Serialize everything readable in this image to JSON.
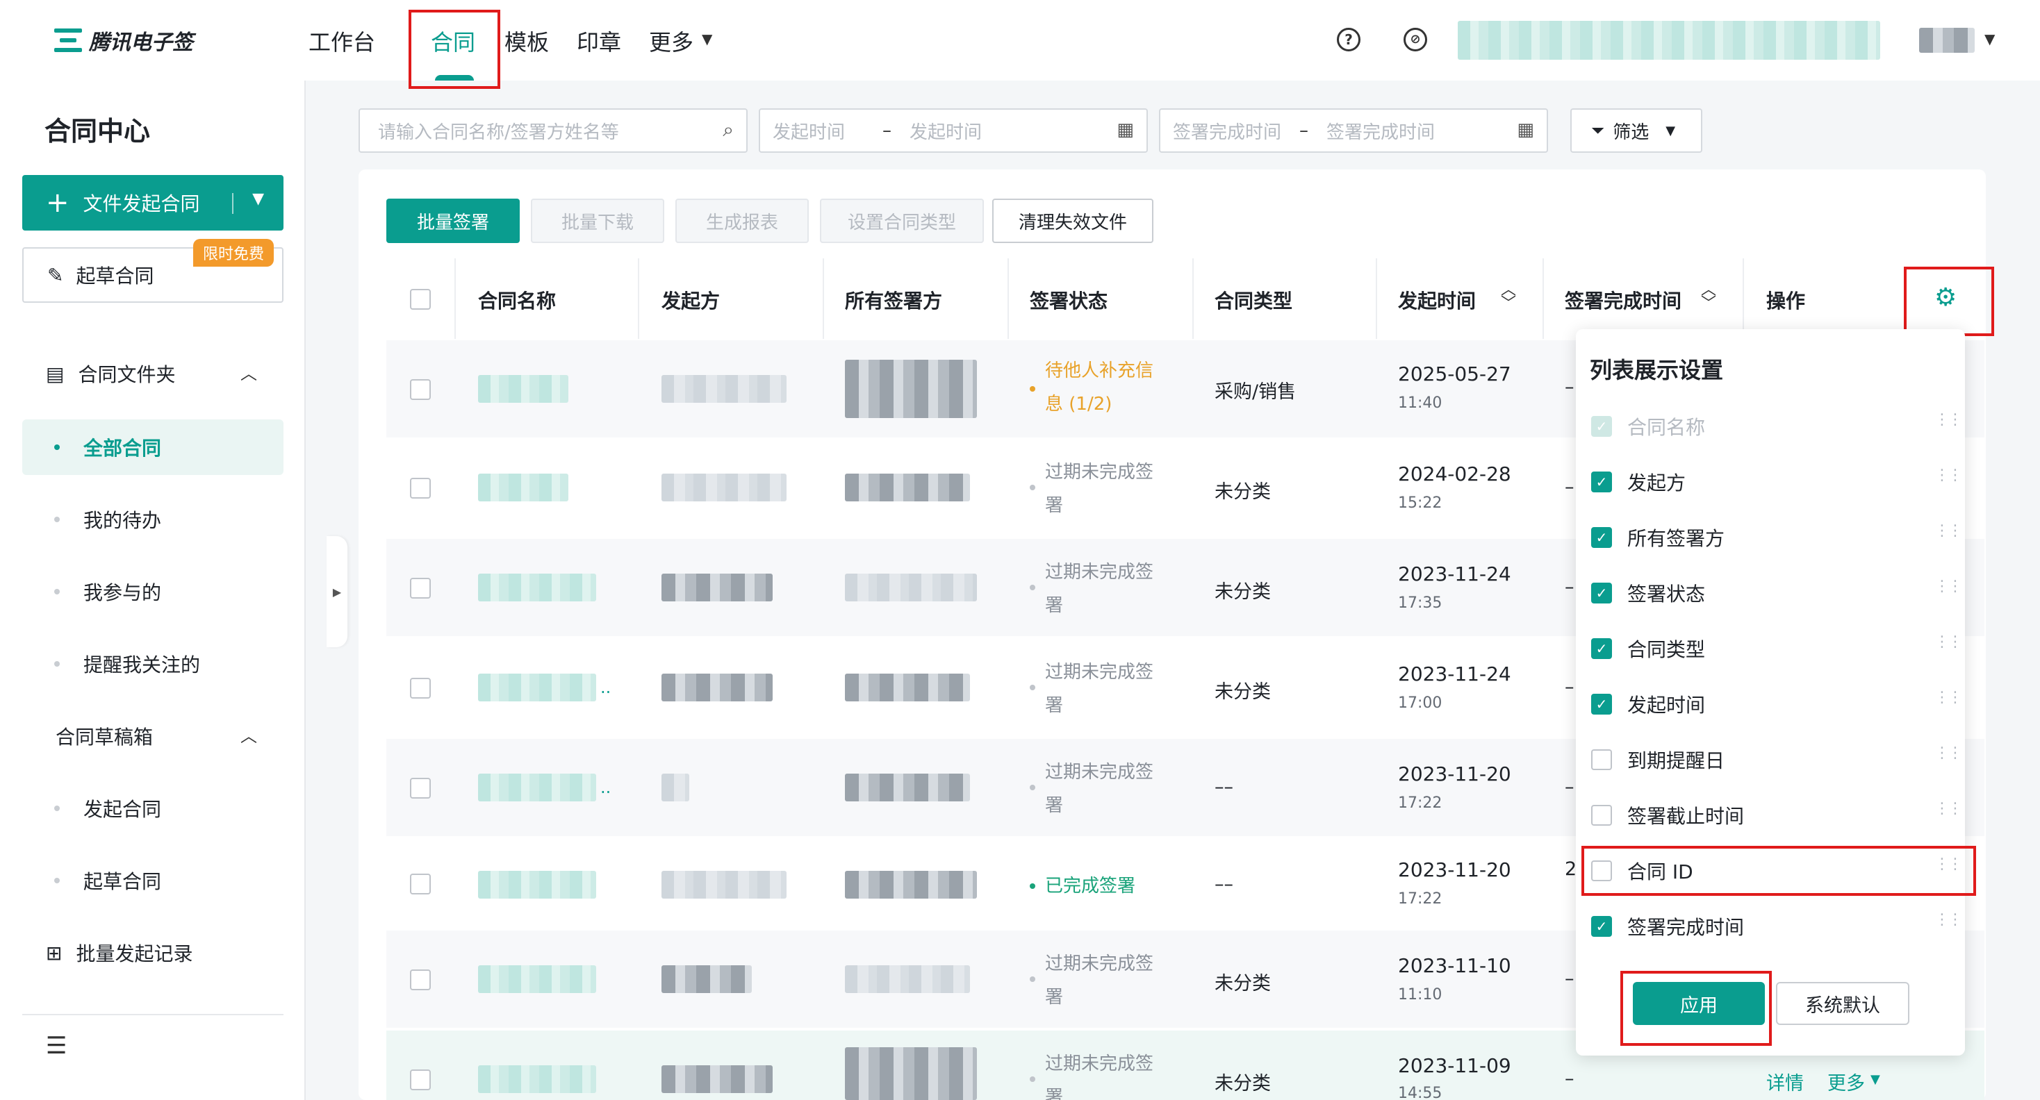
{
  "brand": {
    "name": "腾讯电子签"
  },
  "nav": {
    "items": [
      {
        "label": "工作台"
      },
      {
        "label": "合同"
      },
      {
        "label": "模板"
      },
      {
        "label": "印章"
      },
      {
        "label": "更多"
      }
    ]
  },
  "sidebar": {
    "title": "合同中心",
    "start_button": "文件发起合同",
    "draft_button": "起草合同",
    "badge": "限时免费",
    "folder_section": "合同文件夹",
    "folder_items": [
      {
        "label": "全部合同"
      },
      {
        "label": "我的待办"
      },
      {
        "label": "我参与的"
      },
      {
        "label": "提醒我关注的"
      }
    ],
    "draft_section": "合同草稿箱",
    "draft_items": [
      {
        "label": "发起合同"
      },
      {
        "label": "起草合同"
      }
    ],
    "batch_record": "批量发起记录"
  },
  "filters": {
    "search_placeholder": "请输入合同名称/签署方姓名等",
    "start_from": "发起时间",
    "start_to": "发起时间",
    "finish_from": "签署完成时间",
    "finish_to": "签署完成时间",
    "filter_label": "筛选",
    "range_sep": "–"
  },
  "toolbar": {
    "batch_sign": "批量签署",
    "batch_download": "批量下载",
    "report": "生成报表",
    "set_type": "设置合同类型",
    "clean": "清理失效文件"
  },
  "table": {
    "headers": {
      "name": "合同名称",
      "initiator": "发起方",
      "signers": "所有签署方",
      "status": "签署状态",
      "type": "合同类型",
      "start_time": "发起时间",
      "finish_time": "签署完成时间",
      "actions": "操作"
    },
    "rows": [
      {
        "status_l1": "待他人补充信",
        "status_l2": "息 (1/2)",
        "type": "采购/销售",
        "date": "2025-05-27",
        "time": "11:40",
        "finish": "–"
      },
      {
        "status_l1": "过期未完成签",
        "status_l2": "署",
        "type": "未分类",
        "date": "2024-02-28",
        "time": "15:22",
        "finish": "–"
      },
      {
        "status_l1": "过期未完成签",
        "status_l2": "署",
        "type": "未分类",
        "date": "2023-11-24",
        "time": "17:35",
        "finish": "–"
      },
      {
        "status_l1": "过期未完成签",
        "status_l2": "署",
        "type": "未分类",
        "date": "2023-11-24",
        "time": "17:00",
        "finish": "–"
      },
      {
        "status_l1": "过期未完成签",
        "status_l2": "署",
        "type": "––",
        "date": "2023-11-20",
        "time": "17:22",
        "finish": "–"
      },
      {
        "status_l1": "已完成签署",
        "status_l2": "",
        "type": "––",
        "date": "2023-11-20",
        "time": "17:22",
        "finish": "2"
      },
      {
        "status_l1": "过期未完成签",
        "status_l2": "署",
        "type": "未分类",
        "date": "2023-11-10",
        "time": "11:10",
        "finish": "–"
      },
      {
        "status_l1": "过期未完成签",
        "status_l2": "署",
        "type": "未分类",
        "date": "2023-11-09",
        "time": "14:55",
        "finish": "–"
      }
    ],
    "name_ellipsis": "..",
    "detail_link": "详情",
    "more_link": "更多"
  },
  "column_settings": {
    "title": "列表展示设置",
    "items": [
      {
        "label": "合同名称",
        "state": "disabled"
      },
      {
        "label": "发起方",
        "state": "checked"
      },
      {
        "label": "所有签署方",
        "state": "checked"
      },
      {
        "label": "签署状态",
        "state": "checked"
      },
      {
        "label": "合同类型",
        "state": "checked"
      },
      {
        "label": "发起时间",
        "state": "checked"
      },
      {
        "label": "到期提醒日",
        "state": "unchecked"
      },
      {
        "label": "签署截止时间",
        "state": "unchecked"
      },
      {
        "label": "合同 ID",
        "state": "unchecked"
      },
      {
        "label": "签署完成时间",
        "state": "checked"
      }
    ],
    "apply": "应用",
    "default": "系统默认"
  },
  "icons": {
    "help": "?",
    "link": "⊘",
    "check": "✓",
    "drag": "⋮⋮"
  },
  "colors": {
    "accent": "#0a9d8f",
    "highlight": "#e01b1b",
    "warn": "#e8a22a",
    "success": "#1aa37a",
    "badge": "#f39a2b"
  }
}
